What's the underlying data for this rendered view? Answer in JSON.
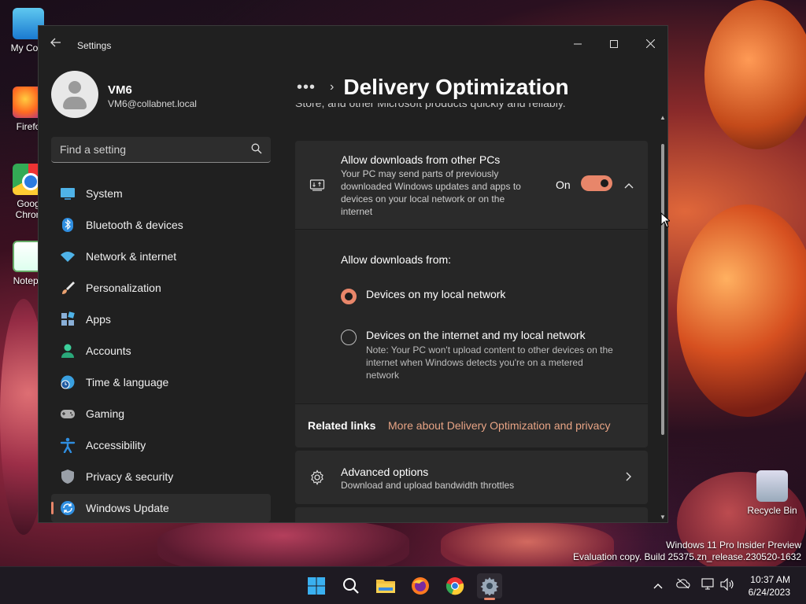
{
  "desktop": {
    "icons": [
      {
        "label": "My Com",
        "icon": "this-pc-icon"
      },
      {
        "label": "Firefo",
        "icon": "firefox-icon"
      },
      {
        "label": "Goog\nChron",
        "icon": "chrome-icon"
      },
      {
        "label": "Notepa",
        "icon": "notepad-icon"
      }
    ],
    "recycle_bin": {
      "label": "Recycle Bin",
      "icon": "recycle-bin-icon"
    },
    "watermark": {
      "line1": "Windows 11 Pro Insider Preview",
      "line2": "Evaluation copy. Build 25375.zn_release.230520-1632"
    }
  },
  "window": {
    "title": "Settings",
    "controls": {
      "minimize": "minimize-icon",
      "maximize": "maximize-icon",
      "close": "close-icon"
    }
  },
  "user": {
    "name": "VM6",
    "email": "VM6@collabnet.local"
  },
  "search": {
    "placeholder": "Find a setting",
    "value": ""
  },
  "sidebar": {
    "items": [
      {
        "label": "System",
        "icon": "system-icon",
        "color": "#4fb3e8"
      },
      {
        "label": "Bluetooth & devices",
        "icon": "bluetooth-icon",
        "color": "#2f8ee0"
      },
      {
        "label": "Network & internet",
        "icon": "wifi-icon",
        "color": "#4fb3e8"
      },
      {
        "label": "Personalization",
        "icon": "brush-icon",
        "color": "#e8a070"
      },
      {
        "label": "Apps",
        "icon": "apps-icon",
        "color": "#8ab0d8"
      },
      {
        "label": "Accounts",
        "icon": "person-icon",
        "color": "#3ccf9a"
      },
      {
        "label": "Time & language",
        "icon": "globe-clock-icon",
        "color": "#3aa0e0"
      },
      {
        "label": "Gaming",
        "icon": "gamepad-icon",
        "color": "#b0b0b0"
      },
      {
        "label": "Accessibility",
        "icon": "accessibility-icon",
        "color": "#2f8ee0"
      },
      {
        "label": "Privacy & security",
        "icon": "shield-icon",
        "color": "#9aa0a8"
      },
      {
        "label": "Windows Update",
        "icon": "update-icon",
        "color": "#2f8ee0",
        "active": true
      }
    ]
  },
  "header": {
    "breadcrumb_more": "•••",
    "title": "Delivery Optimization"
  },
  "faded_text": "Store, and other Microsoft products quickly and reliably.",
  "allow_downloads": {
    "title": "Allow downloads from other PCs",
    "description": "Your PC may send parts of previously downloaded Windows updates and apps to devices on your local network or on the internet",
    "toggle_label": "On",
    "toggle_on": true,
    "sub_label": "Allow downloads from:",
    "options": [
      {
        "label": "Devices on my local network",
        "selected": true,
        "note": ""
      },
      {
        "label": "Devices on the internet and my local network",
        "selected": false,
        "note": "Note: Your PC won't upload content to other devices on the internet when Windows detects you're on a metered network"
      }
    ]
  },
  "related": {
    "title": "Related links",
    "link": "More about Delivery Optimization and privacy"
  },
  "advanced": {
    "title": "Advanced options",
    "subtitle": "Download and upload bandwidth throttles"
  },
  "taskbar": {
    "apps": [
      "start-icon",
      "search-icon",
      "file-explorer-icon",
      "firefox-icon",
      "chrome-icon",
      "settings-icon"
    ],
    "time": "10:37 AM",
    "date": "6/24/2023"
  },
  "colors": {
    "accent": "#e8866a",
    "link": "#e8a485"
  }
}
